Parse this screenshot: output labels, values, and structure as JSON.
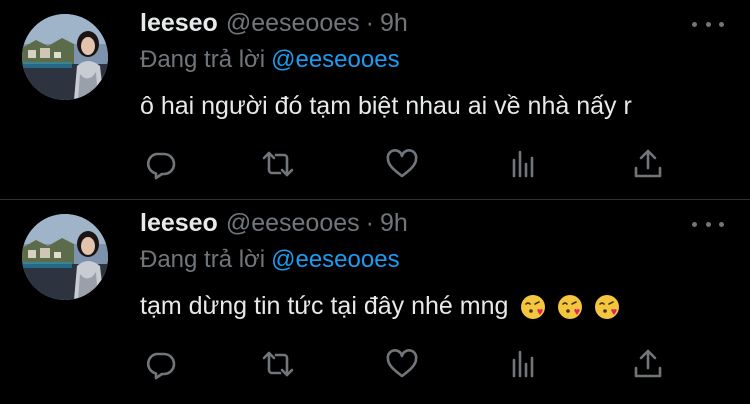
{
  "colors": {
    "background": "#000000",
    "text_primary": "#e7e9ea",
    "text_secondary": "#71767b",
    "accent": "#1d9bf0",
    "divider": "#2f3336"
  },
  "tweets": [
    {
      "display_name": "leeseo",
      "handle": "@eeseooes",
      "separator": "·",
      "time": "9h",
      "reply_prefix": "Đang trả lời",
      "reply_to": "@eeseooes",
      "text": "ô hai người đó tạm biệt nhau ai về nhà nấy r",
      "emojis": []
    },
    {
      "display_name": "leeseo",
      "handle": "@eeseooes",
      "separator": "·",
      "time": "9h",
      "reply_prefix": "Đang trả lời",
      "reply_to": "@eeseooes",
      "text": "tạm dừng tin tức tại đây nhé mng",
      "emojis": [
        "face-blowing-kiss",
        "face-blowing-kiss",
        "face-blowing-kiss"
      ]
    }
  ],
  "action_icons": [
    "reply-icon",
    "retweet-icon",
    "like-icon",
    "analytics-icon",
    "share-icon"
  ]
}
